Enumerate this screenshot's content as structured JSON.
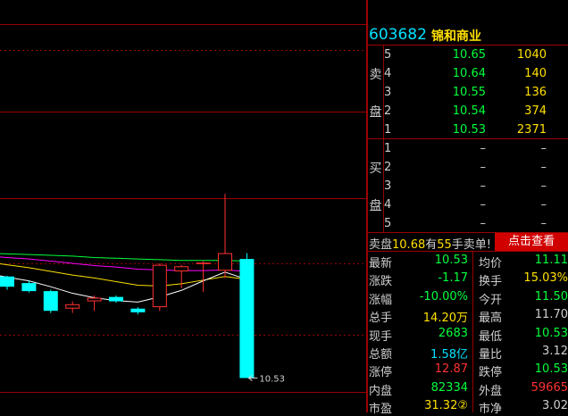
{
  "colors": {
    "up": "#ff3232",
    "down": "#00ffff",
    "ma5": "#ffffff",
    "ma10": "#ffe000",
    "ma20": "#ff00ff",
    "ma30": "#00ff3c",
    "grid": "#9a0000"
  },
  "chart": {
    "low_price_label": "10.53",
    "candles": [
      {
        "o": 11.92,
        "h": 11.93,
        "l": 11.74,
        "c": 11.78
      },
      {
        "o": 11.83,
        "h": 11.86,
        "l": 11.7,
        "c": 11.72
      },
      {
        "o": 11.72,
        "h": 11.74,
        "l": 11.42,
        "c": 11.45
      },
      {
        "o": 11.48,
        "h": 11.58,
        "l": 11.42,
        "c": 11.54
      },
      {
        "o": 11.58,
        "h": 11.66,
        "l": 11.45,
        "c": 11.63
      },
      {
        "o": 11.64,
        "h": 11.66,
        "l": 11.56,
        "c": 11.58
      },
      {
        "o": 11.48,
        "h": 11.5,
        "l": 11.4,
        "c": 11.43
      },
      {
        "o": 11.5,
        "h": 12.1,
        "l": 11.45,
        "c": 12.08
      },
      {
        "o": 11.99,
        "h": 12.08,
        "l": 11.76,
        "c": 12.06
      },
      {
        "o": 12.09,
        "h": 12.13,
        "l": 11.71,
        "c": 12.11
      },
      {
        "o": 12.0,
        "h": 13.05,
        "l": 11.9,
        "c": 12.24
      },
      {
        "o": 12.16,
        "h": 12.24,
        "l": 10.53,
        "c": 10.53
      }
    ],
    "ma5": [
      11.91,
      11.86,
      11.78,
      11.69,
      11.63,
      11.59,
      11.57,
      11.64,
      11.73,
      11.86,
      11.98,
      11.88
    ],
    "ma10": [
      12.08,
      12.04,
      11.99,
      11.94,
      11.9,
      11.85,
      11.8,
      11.79,
      11.82,
      11.87,
      11.92,
      11.88
    ],
    "ma20": [
      12.18,
      12.16,
      12.13,
      12.1,
      12.07,
      12.05,
      12.02,
      12.01,
      12.0,
      12.0,
      12.01,
      11.99
    ],
    "ma30": [
      12.23,
      12.22,
      12.21,
      12.2,
      12.18,
      12.17,
      12.16,
      12.15,
      12.14,
      12.14,
      12.14,
      12.13
    ]
  },
  "header": {
    "code": "603682",
    "name": "锦和商业"
  },
  "sell_side_label": [
    "卖",
    "盘"
  ],
  "buy_side_label": [
    "买",
    "盘"
  ],
  "sell": [
    {
      "level": "5",
      "price": "10.65",
      "vol": "1040"
    },
    {
      "level": "4",
      "price": "10.64",
      "vol": "140"
    },
    {
      "level": "3",
      "price": "10.55",
      "vol": "136"
    },
    {
      "level": "2",
      "price": "10.54",
      "vol": "374"
    },
    {
      "level": "1",
      "price": "10.53",
      "vol": "2371"
    }
  ],
  "buy": [
    {
      "level": "1",
      "price": "–",
      "vol": "–"
    },
    {
      "level": "2",
      "price": "–",
      "vol": "–"
    },
    {
      "level": "3",
      "price": "–",
      "vol": "–"
    },
    {
      "level": "4",
      "price": "–",
      "vol": "–"
    },
    {
      "level": "5",
      "price": "–",
      "vol": "–"
    }
  ],
  "promo": {
    "prefix": "卖盘",
    "price": "10.68",
    "mid": "有",
    "qty": "55",
    "suffix": "手卖单!",
    "button": "点击查看"
  },
  "quotes": [
    {
      "l": "最新",
      "v": "10.53",
      "vc": "g",
      "l2": "均价",
      "v2": "11.11",
      "v2c": "g"
    },
    {
      "l": "涨跌",
      "v": "-1.17",
      "vc": "g",
      "l2": "换手",
      "v2": "15.03%",
      "v2c": "y"
    },
    {
      "l": "涨幅",
      "v": "-10.00%",
      "vc": "g",
      "l2": "今开",
      "v2": "11.50",
      "v2c": "g"
    },
    {
      "l": "总手",
      "v": "14.20万",
      "vc": "y",
      "l2": "最高",
      "v2": "11.70",
      "v2c": "w"
    },
    {
      "l": "现手",
      "v": "2683",
      "vc": "g",
      "l2": "最低",
      "v2": "10.53",
      "v2c": "g"
    },
    {
      "l": "总额",
      "v": "1.58亿",
      "vc": "c",
      "l2": "量比",
      "v2": "3.12",
      "v2c": "w"
    },
    {
      "l": "涨停",
      "v": "12.87",
      "vc": "r",
      "l2": "跌停",
      "v2": "10.53",
      "v2c": "g"
    },
    {
      "l": "内盘",
      "v": "82334",
      "vc": "g",
      "l2": "外盘",
      "v2": "59665",
      "v2c": "r"
    },
    {
      "l": "市盈",
      "v": "31.32②",
      "vc": "y",
      "l2": "市净",
      "v2": "3.02",
      "v2c": "w"
    }
  ]
}
